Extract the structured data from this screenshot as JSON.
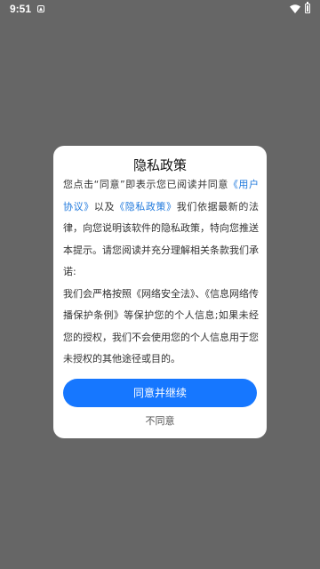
{
  "status_bar": {
    "time": "9:51",
    "icons": [
      "notification-icon",
      "wifi-icon",
      "battery-icon"
    ]
  },
  "dialog": {
    "title": "隐私政策",
    "paragraph1": {
      "prefix": "您点击“同意”即表示您已阅读并同意",
      "link1": "《用户协议》",
      "middle": "以及",
      "link2": "《隐私政策》",
      "suffix": "我们依据最新的法律，向您说明该软件的隐私政策，特向您推送本提示。请您阅读并充分理解相关条款我们承诺:"
    },
    "paragraph2": "我们会严格按照《网络安全法》、《信息网络传播保护条例》等保护您的个人信息;如果未经您的授权，我们不会使用您的个人信息用于您未授权的其他途径或目的。",
    "agree_button": "同意并继续",
    "disagree_button": "不同意"
  },
  "colors": {
    "overlay": "#666666",
    "primary": "#1677FF",
    "link": "#1E78DC"
  }
}
